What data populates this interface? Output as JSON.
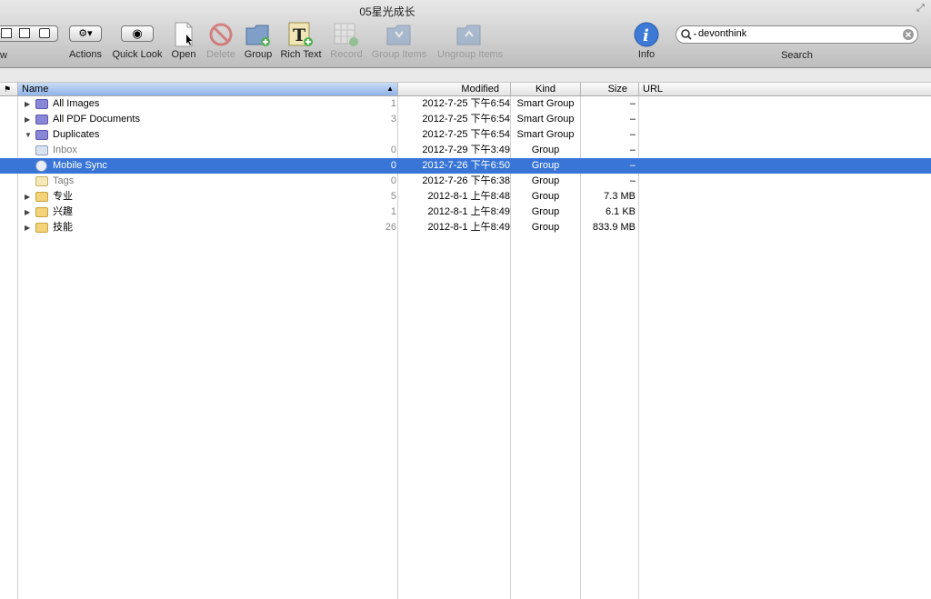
{
  "window": {
    "title": "05星光成长"
  },
  "toolbar": {
    "view_label_fragment": "w",
    "actions": "Actions",
    "quick_look": "Quick Look",
    "open": "Open",
    "delete": "Delete",
    "group": "Group",
    "rich_text": "Rich Text",
    "record": "Record",
    "group_items": "Group Items",
    "ungroup_items": "Ungroup Items",
    "info": "Info"
  },
  "search": {
    "value": "devonthink",
    "label": "Search"
  },
  "columns": {
    "name": "Name",
    "modified": "Modified",
    "kind": "Kind",
    "size": "Size",
    "url": "URL",
    "sort_indicator": "▲"
  },
  "rows": [
    {
      "expander": "▶",
      "icon": "smart-group-icon",
      "name": "All Images",
      "count": "1",
      "modified": "2012-7-25 下午6:54",
      "kind": "Smart Group",
      "size": "–"
    },
    {
      "expander": "▶",
      "icon": "smart-group-icon",
      "name": "All PDF Documents",
      "count": "3",
      "modified": "2012-7-25 下午6:54",
      "kind": "Smart Group",
      "size": "–"
    },
    {
      "expander": "▼",
      "icon": "smart-group-icon",
      "name": "Duplicates",
      "count": "",
      "modified": "2012-7-25 下午6:54",
      "kind": "Smart Group",
      "size": "–"
    },
    {
      "expander": "",
      "icon": "inbox-icon",
      "name": "Inbox",
      "count": "0",
      "modified": "2012-7-29 下午3:49",
      "kind": "Group",
      "size": "–"
    },
    {
      "expander": "",
      "icon": "sync-icon",
      "name": "Mobile Sync",
      "count": "0",
      "modified": "2012-7-26 下午6:50",
      "kind": "Group",
      "size": "–"
    },
    {
      "expander": "",
      "icon": "tags-icon",
      "name": "Tags",
      "count": "0",
      "modified": "2012-7-26 下午6:38",
      "kind": "Group",
      "size": "–"
    },
    {
      "expander": "▶",
      "icon": "folder-icon",
      "name": "专业",
      "count": "5",
      "modified": "2012-8-1 上午8:48",
      "kind": "Group",
      "size": "7.3 MB"
    },
    {
      "expander": "▶",
      "icon": "folder-icon",
      "name": "兴趣",
      "count": "1",
      "modified": "2012-8-1 上午8:49",
      "kind": "Group",
      "size": "6.1 KB"
    },
    {
      "expander": "▶",
      "icon": "folder-icon",
      "name": "技能",
      "count": "26",
      "modified": "2012-8-1 上午8:49",
      "kind": "Group",
      "size": "833.9 MB"
    }
  ],
  "colors": {
    "selection": "#3875d7",
    "sorted_header": "#8fb3e8"
  }
}
